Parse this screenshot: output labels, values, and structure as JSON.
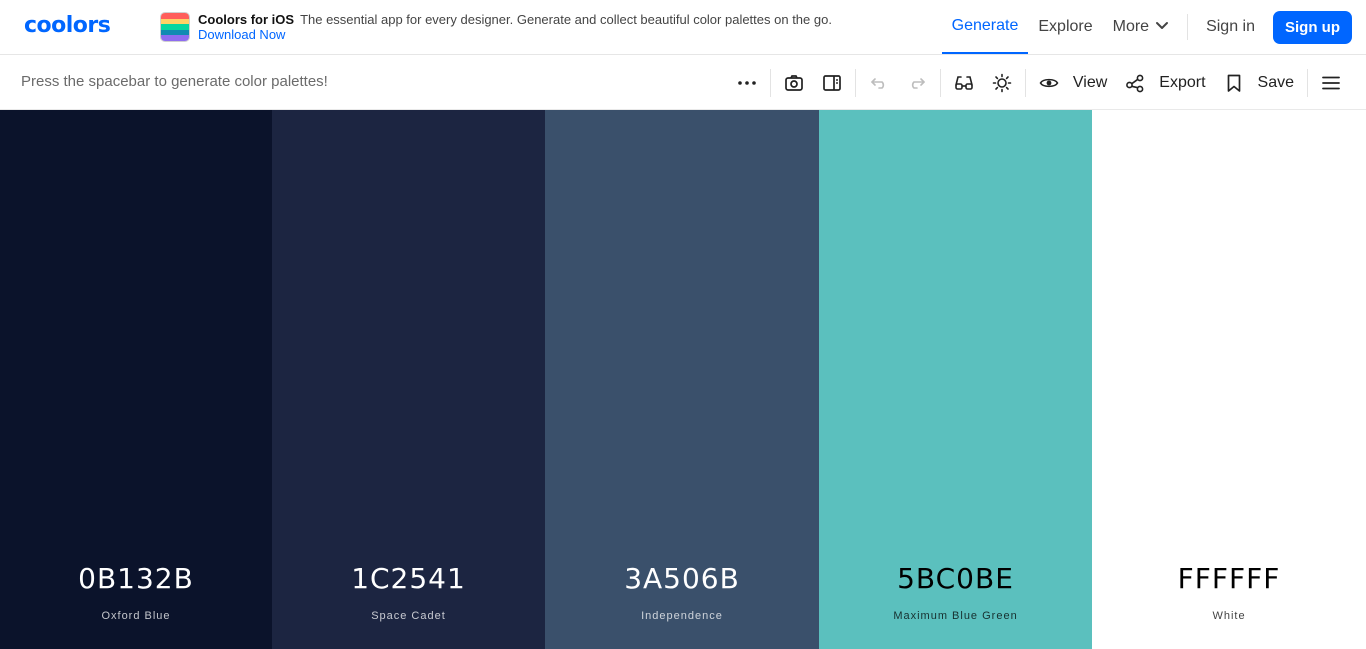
{
  "brand": {
    "logo_text": "coolors",
    "accent": "#0066ff"
  },
  "promo": {
    "title": "Coolors for iOS",
    "description": "The essential app for every designer. Generate and collect beautiful color palettes on the go.",
    "link": "Download Now"
  },
  "nav": {
    "generate": "Generate",
    "explore": "Explore",
    "more": "More",
    "sign_in": "Sign in",
    "sign_up": "Sign up"
  },
  "toolbar": {
    "hint": "Press the spacebar to generate color palettes!",
    "view": "View",
    "export": "Export",
    "save": "Save",
    "icons": [
      "more-options-icon",
      "camera-icon",
      "panel-icon",
      "undo-icon",
      "redo-icon",
      "glasses-icon",
      "sun-icon",
      "eye-icon",
      "share-icon",
      "bookmark-icon",
      "hamburger-menu-icon"
    ]
  },
  "palette": [
    {
      "hex": "0B132B",
      "name": "Oxford Blue",
      "color": "#0B132B",
      "text_color": "#ffffff"
    },
    {
      "hex": "1C2541",
      "name": "Space Cadet",
      "color": "#1C2541",
      "text_color": "#ffffff"
    },
    {
      "hex": "3A506B",
      "name": "Independence",
      "color": "#3A506B",
      "text_color": "#ffffff"
    },
    {
      "hex": "5BC0BE",
      "name": "Maximum Blue Green",
      "color": "#5BC0BE",
      "text_color": "#000000"
    },
    {
      "hex": "FFFFFF",
      "name": "White",
      "color": "#FFFFFF",
      "text_color": "#000000"
    }
  ]
}
